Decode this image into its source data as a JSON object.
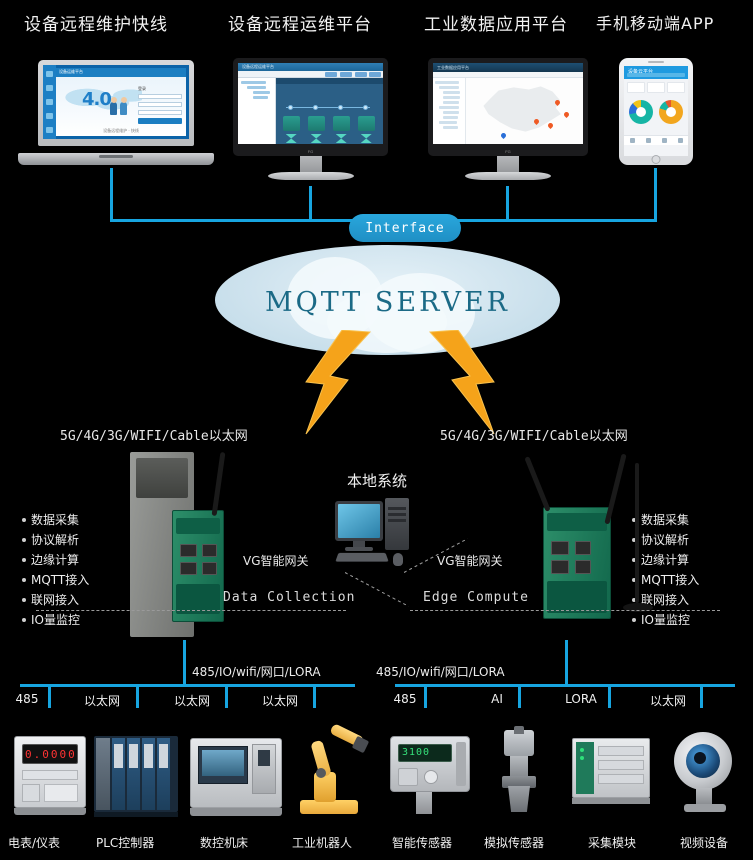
{
  "titles": [
    {
      "text": "设备远程维护快线"
    },
    {
      "text": "设备远程运维平台"
    },
    {
      "text": "工业数据应用平台"
    },
    {
      "text": "手机移动端APP"
    }
  ],
  "screens": {
    "laptop": {
      "app_title": "设备运维平台",
      "hero_text": "4.0",
      "form_label": "登录",
      "login_button": "登 录",
      "footer": "设备远程维护 · 快线"
    },
    "monitor_scada": {
      "app_title": "设备远程运维平台"
    },
    "monitor_map": {
      "app_title": "工业数据应用平台"
    },
    "phone": {
      "app_title": "设备云平台"
    }
  },
  "interface": {
    "label": "Interface"
  },
  "cloud": {
    "label": "MQTT SERVER"
  },
  "links": {
    "left_network": "5G/4G/3G/WIFI/Cable以太网",
    "right_network": "5G/4G/3G/WIFI/Cable以太网"
  },
  "features_left": [
    "数据采集",
    "协议解析",
    "边缘计算",
    "MQTT接入",
    "联网接入",
    "IO量监控"
  ],
  "features_right": [
    "数据采集",
    "协议解析",
    "边缘计算",
    "MQTT接入",
    "联网接入",
    "IO量监控"
  ],
  "local_system": {
    "label": "本地系统"
  },
  "gateways": {
    "left_label": "VG智能网关",
    "right_label": "VG智能网关",
    "left_role": "Data Collection",
    "right_role": "Edge Compute"
  },
  "bus": {
    "left_interfaces": "485/IO/wifi/网口/LORA",
    "right_interfaces": "485/IO/wifi/网口/LORA"
  },
  "port_tags": [
    "485",
    "以太网",
    "以太网",
    "以太网",
    "485",
    "AI",
    "LORA",
    "以太网"
  ],
  "devices": [
    {
      "name": "电表/仪表"
    },
    {
      "name": "PLC控制器"
    },
    {
      "name": "数控机床"
    },
    {
      "name": "工业机器人"
    },
    {
      "name": "智能传感器"
    },
    {
      "name": "模拟传感器"
    },
    {
      "name": "采集模块"
    },
    {
      "name": "视频设备"
    }
  ],
  "colors": {
    "background": "#000000",
    "wire": "#17a5e0",
    "interface_badge": "#29a7dd",
    "cloud": "#cfe3ee",
    "cloud_text": "#1b6a86",
    "lightning": "#f5a31a",
    "gateway_green": "#1f7a5a",
    "gateway_gray": "#8d8f8c"
  }
}
